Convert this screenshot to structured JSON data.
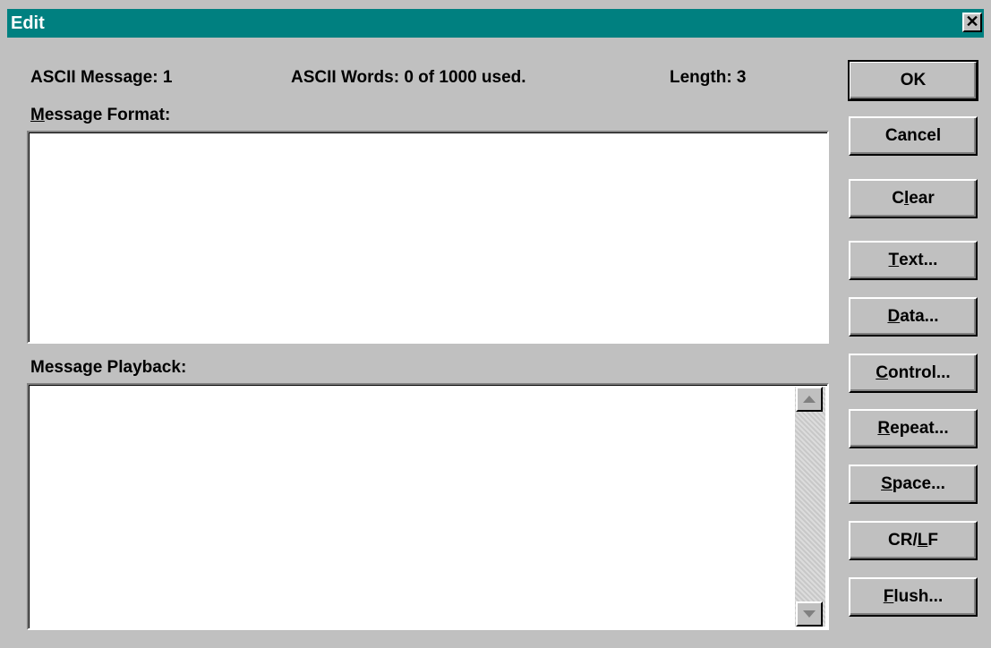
{
  "window": {
    "title": "Edit",
    "close_glyph": "✕"
  },
  "info": {
    "ascii_message": "ASCII Message: 1",
    "ascii_words": "ASCII Words: 0 of 1000 used.",
    "length": "Length: 3"
  },
  "message_format": {
    "label_underlined": "M",
    "label_rest": "essage Format:",
    "value": ""
  },
  "message_playback": {
    "label": "Message Playback:",
    "value": ""
  },
  "buttons": [
    {
      "pre": "",
      "key": "",
      "post": "OK"
    },
    {
      "pre": "",
      "key": "",
      "post": "Cancel"
    },
    {
      "pre": "C",
      "key": "l",
      "post": "ear"
    },
    {
      "pre": "",
      "key": "T",
      "post": "ext..."
    },
    {
      "pre": "",
      "key": "D",
      "post": "ata..."
    },
    {
      "pre": "",
      "key": "C",
      "post": "ontrol..."
    },
    {
      "pre": "",
      "key": "R",
      "post": "epeat..."
    },
    {
      "pre": "",
      "key": "S",
      "post": "pace..."
    },
    {
      "pre": "CR/",
      "key": "L",
      "post": "F"
    },
    {
      "pre": "",
      "key": "F",
      "post": "lush..."
    }
  ],
  "icons": {
    "scroll_up": "scroll-up-arrow-icon",
    "scroll_down": "scroll-down-arrow-icon"
  }
}
